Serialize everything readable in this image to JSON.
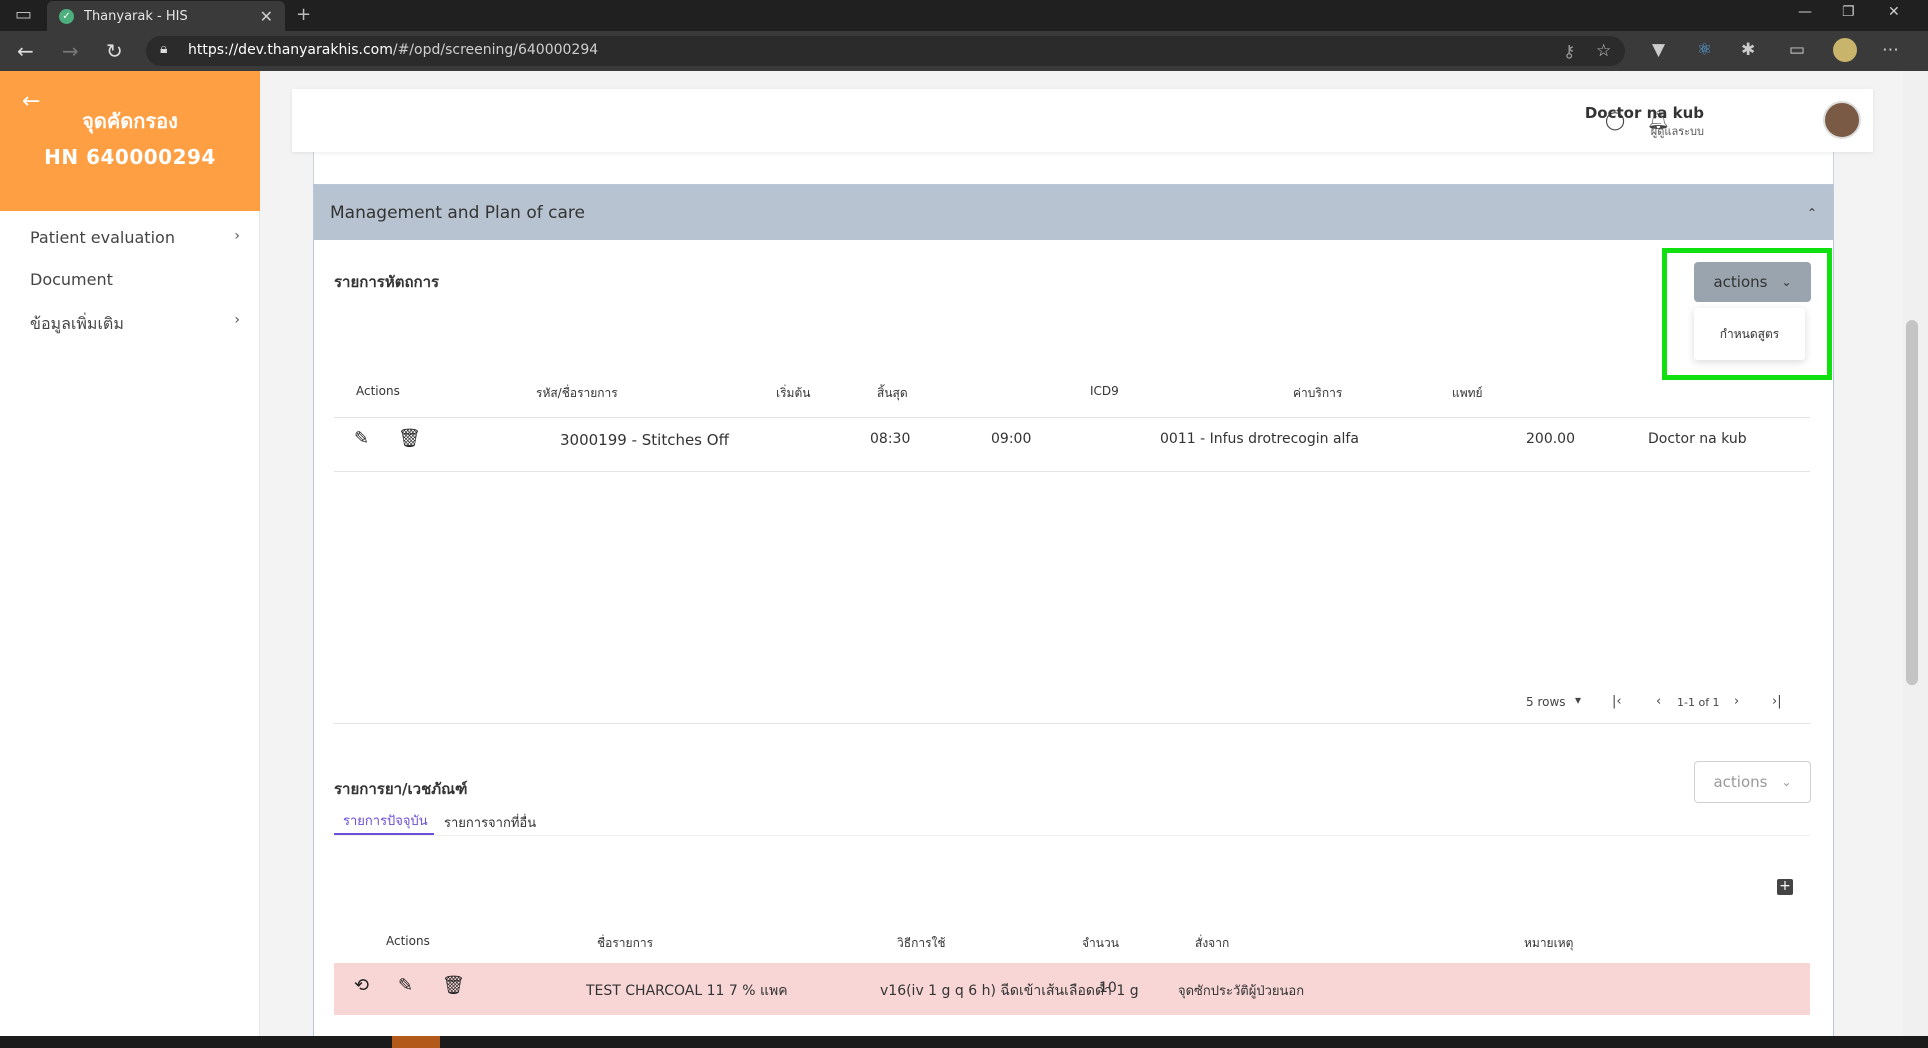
{
  "browser": {
    "tab_title": "Thanyarak - HIS",
    "tab_close": "✕",
    "new_tab": "+",
    "url_host": "https://dev.thanyarakhis.com",
    "url_path": "/#/opd/screening/640000294",
    "win_min": "—",
    "win_max": "❐",
    "win_close": "✕"
  },
  "sidebar": {
    "back": "←",
    "title": "จุดคัดกรอง",
    "hn": "HN 640000294",
    "items": [
      {
        "label": "Patient evaluation",
        "chevron": "›"
      },
      {
        "label": "Document",
        "chevron": ""
      },
      {
        "label": "ข้อมูลเพิ่มเติม",
        "chevron": "›"
      }
    ]
  },
  "header": {
    "user_name": "Doctor na kub",
    "user_role": "ผู้ดูแลระบบ"
  },
  "panel": {
    "title": "Management and Plan of care",
    "collapse": "⌃"
  },
  "procedures": {
    "title": "รายการหัตถการ",
    "actions_label": "actions",
    "dropdown_item": "กำหนดสูตร",
    "columns": [
      "Actions",
      "รหัส/ชื่อรายการ",
      "เริ่มต้น",
      "สิ้นสุด",
      "ICD9",
      "ค่าบริการ",
      "แพทย์"
    ],
    "rows": [
      {
        "item": "3000199 - Stitches Off",
        "start": "08:30",
        "end": "09:00",
        "icd9": "0011 - Infus drotrecogin alfa",
        "price": "200.00",
        "doctor": "Doctor na kub"
      }
    ],
    "pager": {
      "rows": "5 rows",
      "range": "1-1 of 1"
    }
  },
  "drugs": {
    "title": "รายการยา/เวชภัณฑ์",
    "actions_label": "actions",
    "tabs": [
      "รายการปัจจุบัน",
      "รายการจากที่อื่น"
    ],
    "add": "+",
    "columns": [
      "Actions",
      "ชื่อรายการ",
      "วิธีการใช้",
      "จำนวน",
      "สั่งจาก",
      "หมายเหตุ"
    ],
    "rows": [
      {
        "name": "TEST CHARCOAL 11 7 % แพค",
        "usage": "v16(iv 1 g q 6 h) ฉีดเข้าเส้นเลือดดำ 1 g",
        "qty": "10",
        "from": "จุดซักประวัติผู้ป่วยนอก",
        "note": ""
      }
    ]
  },
  "colors": {
    "accent": "#ff9f43",
    "panel_head": "#b7c3d0",
    "highlight": "#10e010",
    "row_warn": "#f8d6d6"
  }
}
